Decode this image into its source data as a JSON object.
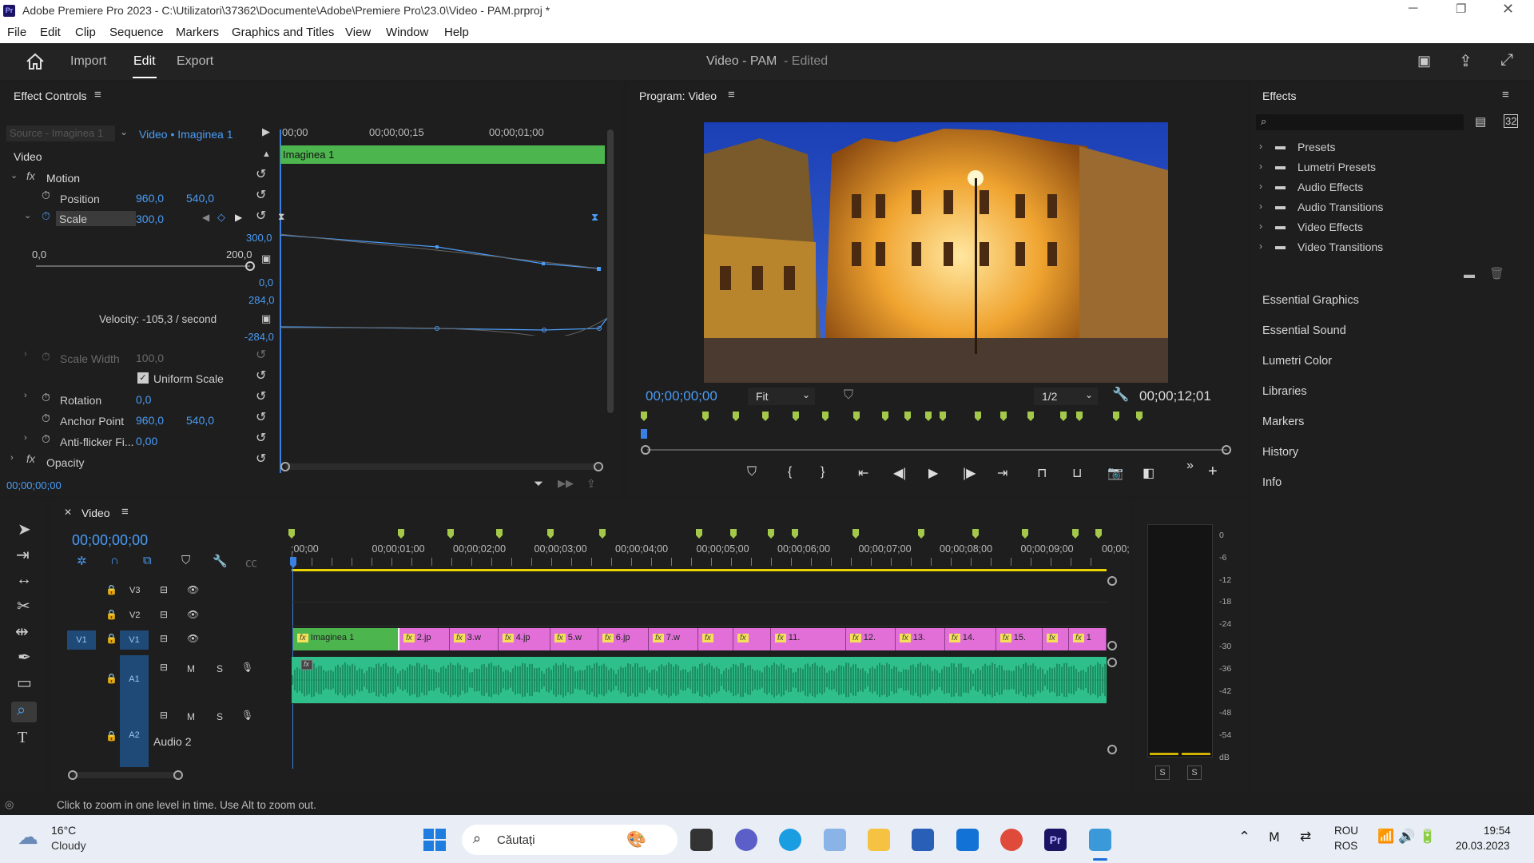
{
  "window": {
    "title": "Adobe Premiere Pro 2023 - C:\\Utilizatori\\37362\\Documente\\Adobe\\Premiere Pro\\23.0\\Video - PAM.prproj *",
    "app_icon": "Pr"
  },
  "menu": [
    "File",
    "Edit",
    "Clip",
    "Sequence",
    "Markers",
    "Graphics and Titles",
    "View",
    "Window",
    "Help"
  ],
  "header": {
    "tabs": [
      "Import",
      "Edit",
      "Export"
    ],
    "active_tab": "Edit",
    "project": "Video - PAM",
    "status": "- Edited"
  },
  "effect_controls": {
    "title": "Effect Controls",
    "source": "Source - Imaginea 1",
    "target": "Video • Imaginea 1",
    "ruler": [
      "00;00",
      "00;00;00;15",
      "00;00;01;00"
    ],
    "clip_label": "Imaginea 1",
    "section": "Video",
    "motion": "Motion",
    "position": {
      "label": "Position",
      "x": "960,0",
      "y": "540,0"
    },
    "scale": {
      "label": "Scale",
      "value": "300,0",
      "min": "0,0",
      "max": "200,0",
      "graph_top": "300,0",
      "graph_zero": "0,0",
      "vel_top": "284,0",
      "vel_bottom": "-284,0",
      "velocity": "Velocity: -105,3 / second"
    },
    "scale_width": {
      "label": "Scale Width",
      "value": "100,0"
    },
    "uniform_scale": "Uniform Scale",
    "rotation": {
      "label": "Rotation",
      "value": "0,0"
    },
    "anchor": {
      "label": "Anchor Point",
      "x": "960,0",
      "y": "540,0"
    },
    "antiflicker": {
      "label": "Anti-flicker Fi...",
      "value": "0,00"
    },
    "opacity": "Opacity",
    "timecode": "00;00;00;00"
  },
  "program": {
    "title": "Program: Video",
    "timecode": "00;00;00;00",
    "fit": "Fit",
    "resolution": "1/2",
    "duration": "00;00;12;01"
  },
  "effects": {
    "title": "Effects",
    "items": [
      "Presets",
      "Lumetri Presets",
      "Audio Effects",
      "Audio Transitions",
      "Video Effects",
      "Video Transitions"
    ]
  },
  "right_panels": [
    "Essential Graphics",
    "Essential Sound",
    "Lumetri Color",
    "Libraries",
    "Markers",
    "History",
    "Info"
  ],
  "timeline": {
    "title": "Video",
    "timecode": "00;00;00;00",
    "ruler": [
      ";00;00",
      "00;00;01;00",
      "00;00;02;00",
      "00;00;03;00",
      "00;00;04;00",
      "00;00;05;00",
      "00;00;06;00",
      "00;00;07;00",
      "00;00;08;00",
      "00;00;09;00",
      "00;00;"
    ],
    "tracks": [
      "V3",
      "V2",
      "V1",
      "A1",
      "A2"
    ],
    "v1_src": "V1",
    "a1_src": "A1",
    "audio2": "Audio 2",
    "track_buttons": {
      "mute": "M",
      "solo": "S"
    },
    "clips": [
      "Imaginea 1",
      "2.jp",
      "3.w",
      "4.jp",
      "5.w",
      "6.jp",
      "7.w",
      "",
      "",
      "11.",
      "12.",
      "13.",
      "14.",
      "15.",
      "",
      "1"
    ]
  },
  "meter": {
    "scale": [
      "0",
      "-6",
      "-12",
      "-18",
      "-24",
      "-30",
      "-36",
      "-42",
      "-48",
      "-54",
      "dB"
    ],
    "solo": [
      "S",
      "S"
    ]
  },
  "status_bar": "Click to zoom in one level in time. Use Alt to zoom out.",
  "taskbar": {
    "temp": "16°C",
    "weather": "Cloudy",
    "search": "Căutați",
    "lang1": "ROU",
    "lang2": "ROS",
    "time": "19:54",
    "date": "20.03.2023"
  }
}
